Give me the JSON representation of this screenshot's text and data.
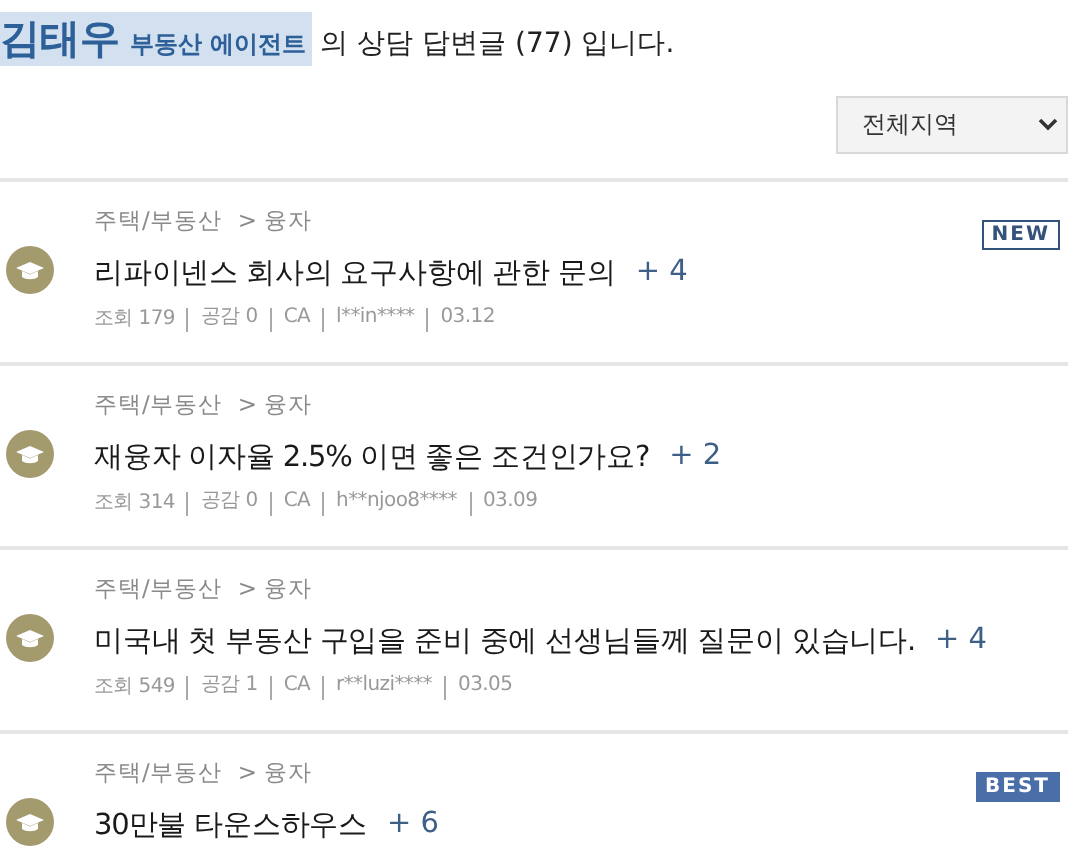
{
  "heading": {
    "name": "김태우",
    "role": "부동산 에이전트",
    "text": "의 상담 답변글 (77) 입니다."
  },
  "region_select": {
    "value": "전체지역"
  },
  "posts": [
    {
      "category": "주택/부동산",
      "subcategory": "> 융자",
      "title": "리파이넨스 회사의 요구사항에 관한 문의",
      "answers": "+ 4",
      "badge": {
        "kind": "new",
        "text": "NEW"
      },
      "meta": [
        "조회 179",
        "공감 0",
        "CA",
        "l**in****",
        "03.12"
      ]
    },
    {
      "category": "주택/부동산",
      "subcategory": "> 융자",
      "title": "재융자 이자율 2.5% 이면 좋은 조건인가요?",
      "answers": "+ 2",
      "meta": [
        "조회 314",
        "공감 0",
        "CA",
        "h**njoo8****",
        "03.09"
      ]
    },
    {
      "category": "주택/부동산",
      "subcategory": "> 융자",
      "title": "미국내 첫 부동산 구입을 준비 중에 선생님들께 질문이 있습니다.",
      "answers": "+ 4",
      "meta": [
        "조회 549",
        "공감 1",
        "CA",
        "r**luzi****",
        "03.05"
      ]
    },
    {
      "category": "주택/부동산",
      "subcategory": "> 융자",
      "title": "30만불 타운스하우스",
      "answers": "+ 6",
      "badge": {
        "kind": "best",
        "text": "BEST"
      }
    }
  ]
}
